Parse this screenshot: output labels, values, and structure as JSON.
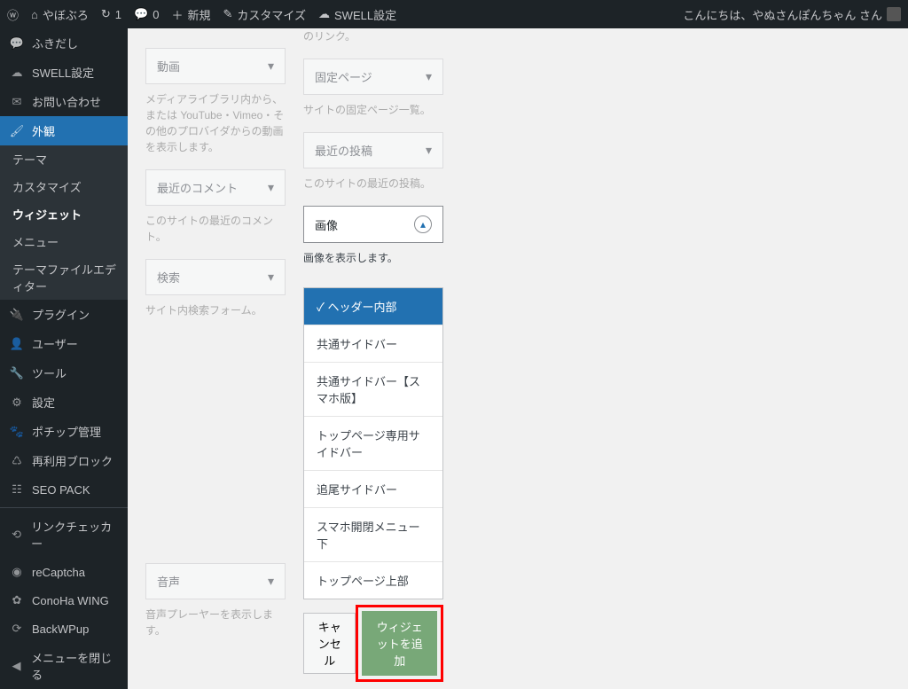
{
  "admin_bar": {
    "site_name": "やぼぶろ",
    "updates": "1",
    "comments": "0",
    "new": "新規",
    "customize": "カスタマイズ",
    "swell": "SWELL設定",
    "greeting": "こんにちは、やぬさんぽんちゃん さん"
  },
  "sidebar": {
    "items": [
      {
        "label": "ふきだし",
        "icon": "💬"
      },
      {
        "label": "SWELL設定",
        "icon": "☁"
      },
      {
        "label": "お問い合わせ",
        "icon": "✉"
      },
      {
        "label": "外観",
        "icon": "🖌",
        "current": true
      },
      {
        "label": "プラグイン",
        "icon": "🔌"
      },
      {
        "label": "ユーザー",
        "icon": "👤"
      },
      {
        "label": "ツール",
        "icon": "🔧"
      },
      {
        "label": "設定",
        "icon": "⚙"
      },
      {
        "label": "ポチップ管理",
        "icon": "🐾"
      },
      {
        "label": "再利用ブロック",
        "icon": "♺"
      },
      {
        "label": "SEO PACK",
        "icon": "📊"
      },
      {
        "label": "リンクチェッカー",
        "icon": "🔗"
      },
      {
        "label": "reCaptcha",
        "icon": "●"
      },
      {
        "label": "ConoHa WING",
        "icon": "✿"
      },
      {
        "label": "BackWPup",
        "icon": "⟳"
      },
      {
        "label": "メニューを閉じる",
        "icon": "◀"
      }
    ],
    "submenu": [
      {
        "label": "テーマ"
      },
      {
        "label": "カスタマイズ"
      },
      {
        "label": "ウィジェット",
        "current": true
      },
      {
        "label": "メニュー"
      },
      {
        "label": "テーマファイルエディター"
      }
    ]
  },
  "widgets_left": [
    {
      "title": "動画",
      "desc": "メディアライブラリ内から、または YouTube・Vimeo・その他のプロバイダからの動画を表示します。"
    },
    {
      "title": "最近のコメント",
      "desc": "このサイトの最近のコメント。"
    },
    {
      "title": "検索",
      "desc": "サイト内検索フォーム。"
    },
    {
      "title": "音声",
      "desc": "音声プレーヤーを表示します。"
    }
  ],
  "widgets_right_top_desc": "のリンク。",
  "widgets_right": [
    {
      "title": "固定ページ",
      "desc": "サイトの固定ページ一覧。"
    },
    {
      "title": "最近の投稿",
      "desc": "このサイトの最近の投稿。"
    }
  ],
  "image_widget": {
    "title": "画像",
    "desc": "画像を表示します。"
  },
  "areas": [
    "ヘッダー内部",
    "共通サイドバー",
    "共通サイドバー【スマホ版】",
    "トップページ専用サイドバー",
    "追尾サイドバー",
    "スマホ開閉メニュー下",
    "トップページ上部"
  ],
  "actions": {
    "cancel": "キャンセル",
    "add": "ウィジェットを追加"
  }
}
